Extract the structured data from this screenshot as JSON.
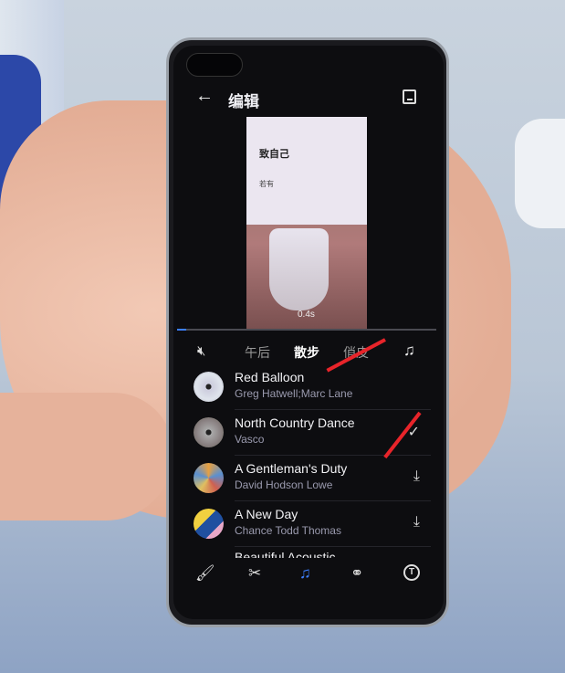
{
  "header": {
    "title": "编辑",
    "back_icon": "arrow-left-icon",
    "save_icon": "save-icon"
  },
  "preview": {
    "card_title": "致自己",
    "card_subtitle": "若有",
    "time": "0.4s",
    "progress_percent": 3
  },
  "styles": {
    "items": [
      "午后",
      "散步",
      "俏皮"
    ],
    "selected": "散步",
    "mute_icon": "mute-icon",
    "music_icon": "music-note-icon"
  },
  "songs": [
    {
      "title": "Red Balloon",
      "artist": "Greg  Hatwell;Marc  Lane",
      "status": ""
    },
    {
      "title": "North Country Dance",
      "artist": "Vasco",
      "status": "✓"
    },
    {
      "title": "A Gentleman's Duty",
      "artist": "David Hodson Lowe",
      "status": "⤓"
    },
    {
      "title": "A New Day",
      "artist": "Chance Todd Thomas",
      "status": "⤓"
    },
    {
      "title": "Beautiful Acoustic",
      "artist": "",
      "status": ""
    }
  ],
  "bottom_tabs": [
    {
      "name": "theme",
      "icon": "paint-roller-icon"
    },
    {
      "name": "edit",
      "icon": "scissors-icon"
    },
    {
      "name": "music",
      "icon": "music-note-icon",
      "active": true
    },
    {
      "name": "filter",
      "icon": "filter-circles-icon"
    },
    {
      "name": "text",
      "icon": "text-icon"
    }
  ],
  "colors": {
    "accent": "#3d7fff",
    "annotation_arrow": "#e8242a"
  }
}
